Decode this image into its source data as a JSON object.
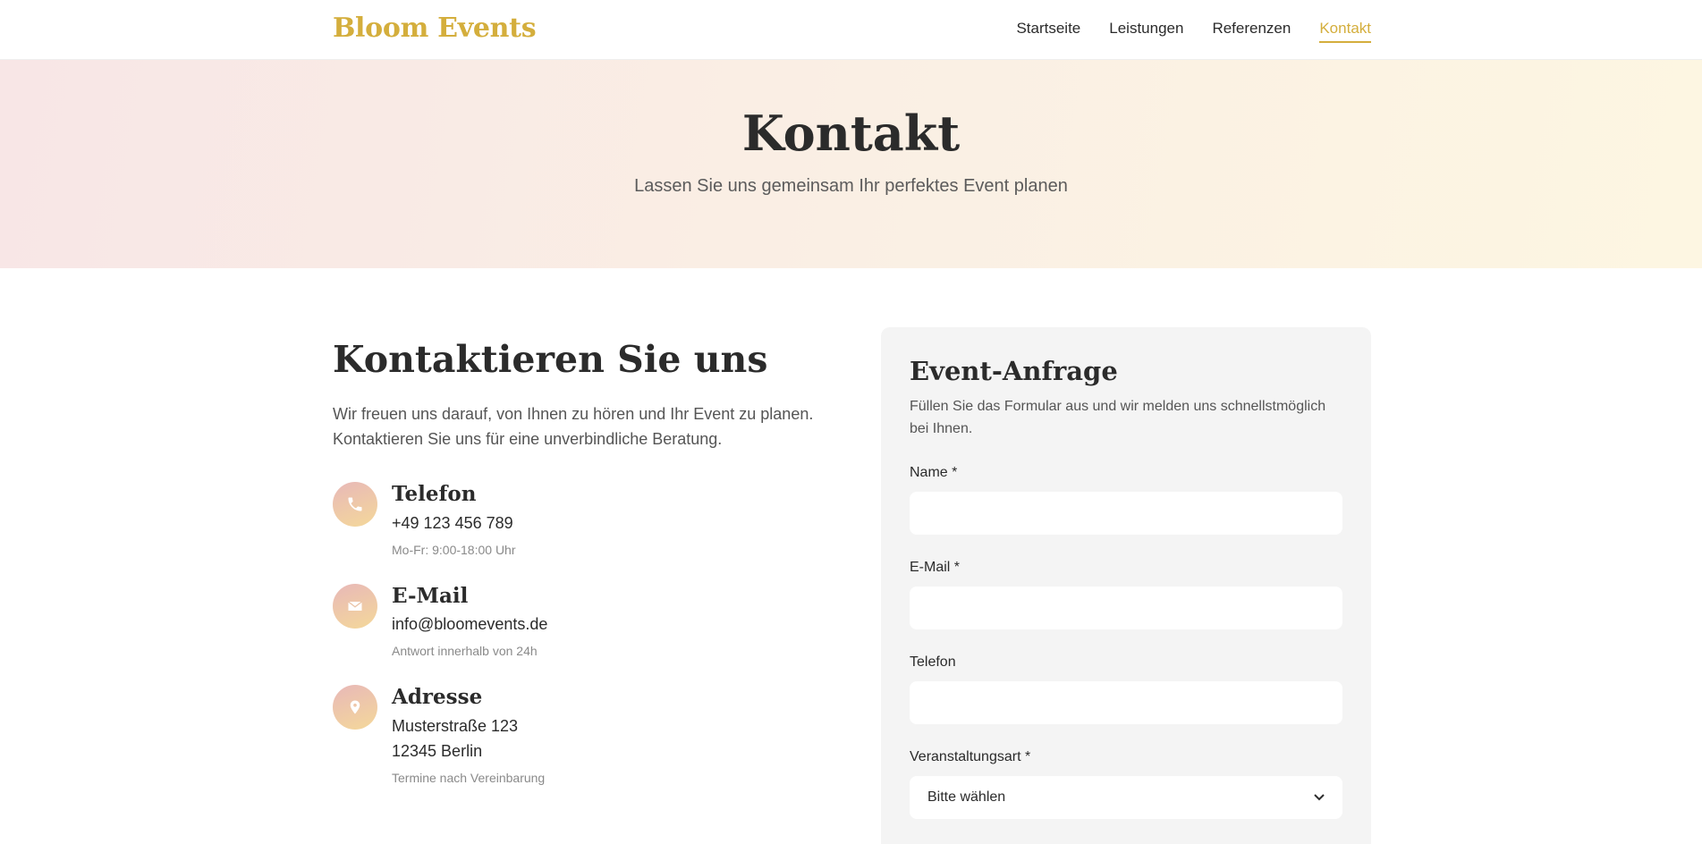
{
  "header": {
    "logo": "Bloom Events",
    "nav": [
      {
        "label": "Startseite"
      },
      {
        "label": "Leistungen"
      },
      {
        "label": "Referenzen"
      },
      {
        "label": "Kontakt",
        "active": true
      }
    ]
  },
  "hero": {
    "title": "Kontakt",
    "subtitle": "Lassen Sie uns gemeinsam Ihr perfektes Event planen"
  },
  "contact": {
    "heading": "Kontaktieren Sie uns",
    "intro": "Wir freuen uns darauf, von Ihnen zu hören und Ihr Event zu planen. Kontaktieren Sie uns für eine unverbindliche Beratung.",
    "items": [
      {
        "icon": "phone-icon",
        "title": "Telefon",
        "lines": [
          "+49 123 456 789"
        ],
        "note": "Mo-Fr: 9:00-18:00 Uhr"
      },
      {
        "icon": "mail-icon",
        "title": "E-Mail",
        "lines": [
          "info@bloomevents.de"
        ],
        "note": "Antwort innerhalb von 24h"
      },
      {
        "icon": "location-pin-icon",
        "title": "Adresse",
        "lines": [
          "Musterstraße 123",
          "12345 Berlin"
        ],
        "note": "Termine nach Vereinbarung"
      }
    ]
  },
  "form": {
    "title": "Event-Anfrage",
    "subtitle": "Füllen Sie das Formular aus und wir melden uns schnellstmöglich bei Ihnen.",
    "fields": {
      "name": {
        "label": "Name *",
        "value": ""
      },
      "email": {
        "label": "E-Mail *",
        "value": ""
      },
      "phone": {
        "label": "Telefon",
        "value": ""
      },
      "event_type": {
        "label": "Veranstaltungsart *",
        "selected": "Bitte wählen"
      }
    }
  },
  "colors": {
    "accent": "#d4ae3c",
    "card_bg": "#f4f4f4"
  }
}
